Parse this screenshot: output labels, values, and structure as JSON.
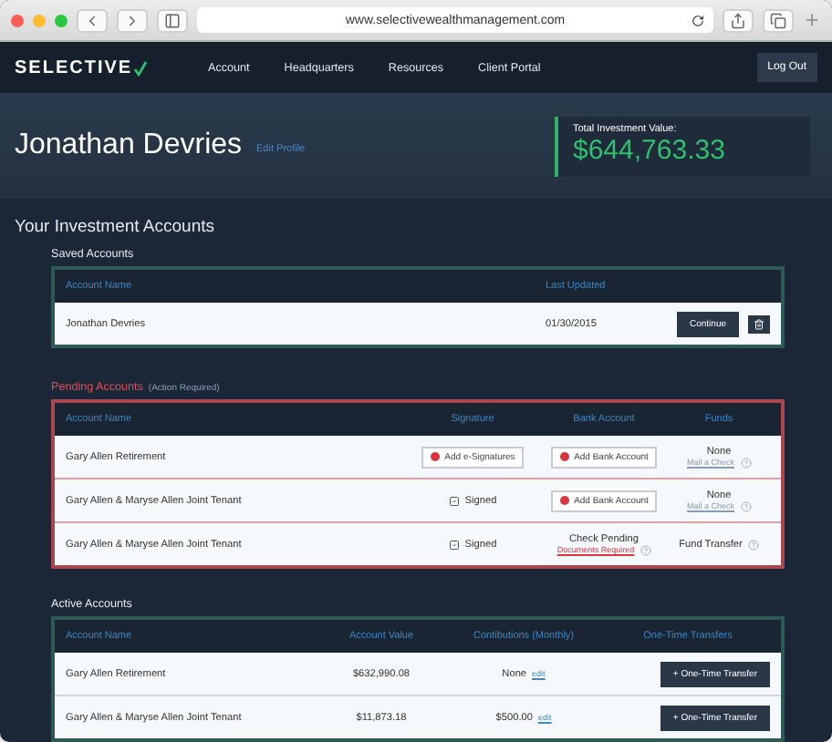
{
  "browser": {
    "url": "www.selectivewealthmanagement.com"
  },
  "nav": {
    "logo": "SELECTIVE",
    "links": [
      "Account",
      "Headquarters",
      "Resources",
      "Client Portal"
    ],
    "logout": "Log Out"
  },
  "hero": {
    "name": "Jonathan Devries",
    "edit_link": "Edit Profile",
    "total_label": "Total Investment Value:",
    "total_value": "$644,763.33"
  },
  "heading": "Your Investment Accounts",
  "saved": {
    "title": "Saved Accounts",
    "columns": [
      "Account Name",
      "Last Updated"
    ],
    "rows": [
      {
        "name": "Jonathan Devries",
        "updated": "01/30/2015",
        "action": "Continue"
      }
    ]
  },
  "pending": {
    "title": "Pending Accounts",
    "note": "(Action Required)",
    "columns": [
      "Account Name",
      "Signature",
      "Bank Account",
      "Funds"
    ],
    "rows": [
      {
        "name": "Gary Allen Retirement",
        "signature": {
          "kind": "button",
          "text": "Add e-Signatures"
        },
        "bank": {
          "kind": "button",
          "text": "Add Bank Account"
        },
        "funds": {
          "text": "None",
          "link": "Mail a Check"
        }
      },
      {
        "name": "Gary Allen & Maryse Allen Joint Tenant",
        "signature": {
          "kind": "signed",
          "text": "Signed"
        },
        "bank": {
          "kind": "button",
          "text": "Add Bank Account"
        },
        "funds": {
          "text": "None",
          "link": "Mail a Check"
        }
      },
      {
        "name": "Gary Allen & Maryse Allen Joint Tenant",
        "signature": {
          "kind": "signed",
          "text": "Signed"
        },
        "bank": {
          "kind": "pending",
          "text": "Check Pending",
          "link": "Documents Required"
        },
        "funds": {
          "text": "Fund Transfer"
        }
      }
    ]
  },
  "active": {
    "title": "Active Accounts",
    "columns": [
      "Account Name",
      "Account Value",
      "Contibutions (Monthly)",
      "One-Time Transfers"
    ],
    "rows": [
      {
        "name": "Gary Allen Retirement",
        "value": "$632,990.08",
        "contribution": "None",
        "edit": "edit",
        "action": "+ One-Time Transfer"
      },
      {
        "name": "Gary Allen & Maryse Allen Joint Tenant",
        "value": "$11,873.18",
        "contribution": "$500.00",
        "edit": "edit",
        "action": "+ One-Time Transfer"
      }
    ]
  }
}
